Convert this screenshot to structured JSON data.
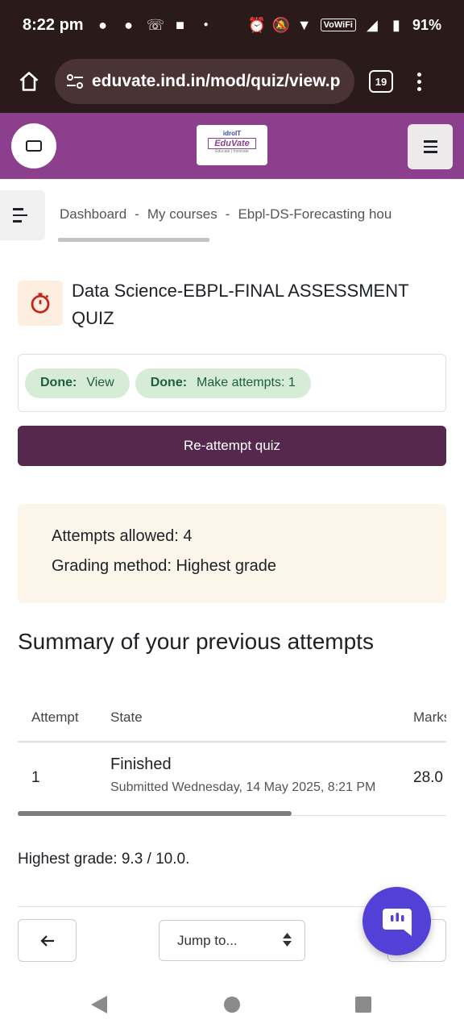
{
  "status_bar": {
    "time": "8:22 pm",
    "network": "VoWiFi",
    "battery": "91%"
  },
  "browser": {
    "url": "eduvate.ind.in/mod/quiz/view.p",
    "tab_count": "19"
  },
  "site": {
    "logo_top": "idroIT",
    "logo_name": "EduVate",
    "logo_tagline": "Educate | Innovate"
  },
  "breadcrumb": {
    "items": [
      "Dashboard",
      "My courses",
      "Ebpl-DS-Forecasting hou"
    ],
    "separator": "-"
  },
  "quiz": {
    "title": "Data Science-EBPL-FINAL ASSESSMENT QUIZ",
    "completion": [
      {
        "status": "Done:",
        "label": "View"
      },
      {
        "status": "Done:",
        "label": "Make attempts: 1"
      }
    ],
    "reattempt_label": "Re-attempt quiz",
    "attempts_allowed": "Attempts allowed: 4",
    "grading_method": "Grading method: Highest grade"
  },
  "summary": {
    "title": "Summary of your previous attempts",
    "columns": [
      "Attempt",
      "State",
      "Marks"
    ],
    "rows": [
      {
        "attempt": "1",
        "state": "Finished",
        "submitted": "Submitted Wednesday, 14 May 2025, 8:21 PM",
        "marks": "28.0"
      }
    ],
    "highest_grade": "Highest grade: 9.3 / 10.0."
  },
  "footer_nav": {
    "jump_label": "Jump to..."
  },
  "colors": {
    "brand": "#8c3f8c",
    "primary_button": "#55284e",
    "success_pill": "#d7ecd7",
    "chat_fab": "#5340d6"
  }
}
